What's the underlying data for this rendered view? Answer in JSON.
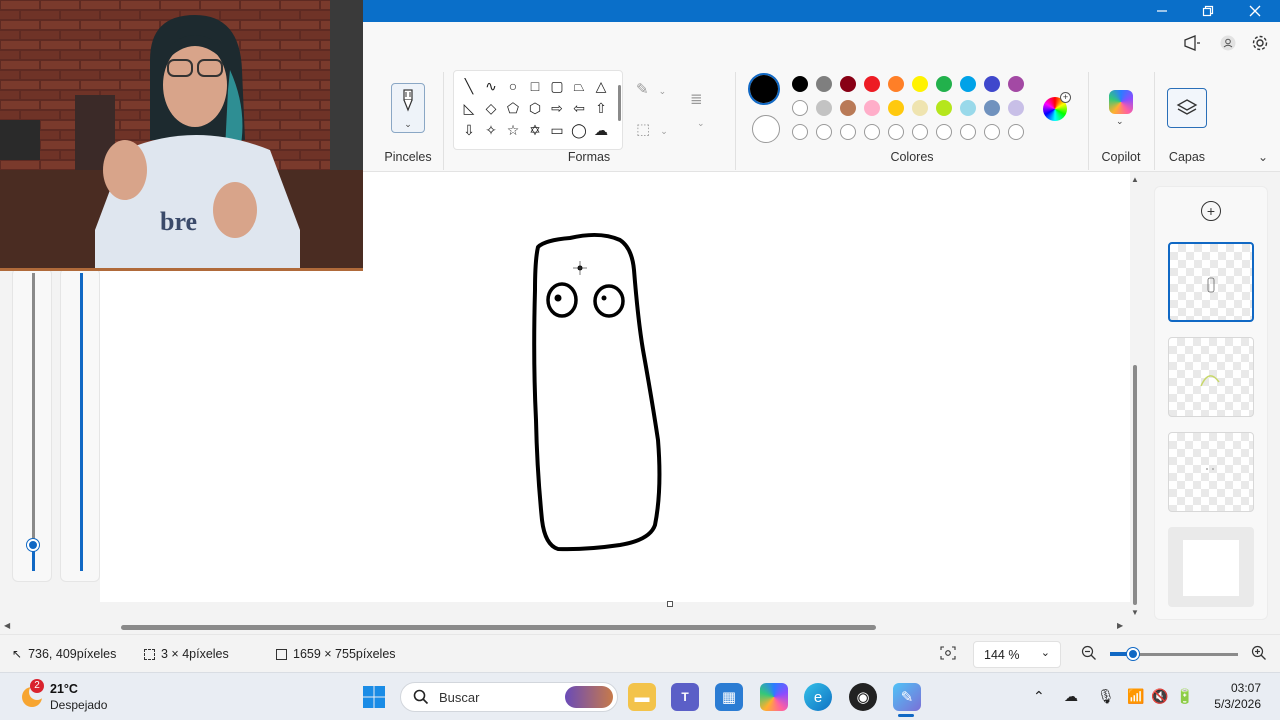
{
  "ribbon": {
    "brushes_label": "Pinceles",
    "shapes_label": "Formas",
    "colors_label": "Colores",
    "copilot_label": "Copilot",
    "layers_label": "Capas",
    "primary_color": "#000000",
    "secondary_color": "#ffffff",
    "palette_row1": [
      "#000000",
      "#7f7f7f",
      "#880015",
      "#ed1c24",
      "#ff7f27",
      "#fff200",
      "#22b14c",
      "#00a2e8",
      "#3f48cc",
      "#a349a4"
    ],
    "palette_row2": [
      "#ffffff",
      "#c3c3c3",
      "#b97a57",
      "#ffaec9",
      "#ffc90e",
      "#efe4b0",
      "#b5e61d",
      "#99d9ea",
      "#7092be",
      "#c8bfe7"
    ],
    "shape_icons": [
      "line",
      "curve",
      "oval",
      "rectangle",
      "rounded-rectangle",
      "polygon",
      "triangle",
      "right-triangle",
      "diamond",
      "pentagon",
      "hexagon",
      "right-arrow",
      "left-arrow",
      "up-arrow",
      "down-arrow",
      "four-point-star",
      "five-point-star",
      "six-point-star",
      "speech-bubble-rect",
      "speech-bubble-oval",
      "speech-bubble-cloud"
    ]
  },
  "status": {
    "cursor_pos": "736, 409píxeles",
    "selection_size": "3 × 4píxeles",
    "canvas_size": "1659 × 755píxeles",
    "zoom": "144 %"
  },
  "taskbar": {
    "weather_temp": "21°C",
    "weather_desc": "Despejado",
    "weather_badge": "2",
    "search_placeholder": "Buscar",
    "time": "03:07",
    "date": "5/3/2026"
  },
  "webcam": {
    "shirt_text": "bre"
  },
  "colors": {
    "accent": "#1068c4",
    "titlebar": "#0a6fc9"
  }
}
